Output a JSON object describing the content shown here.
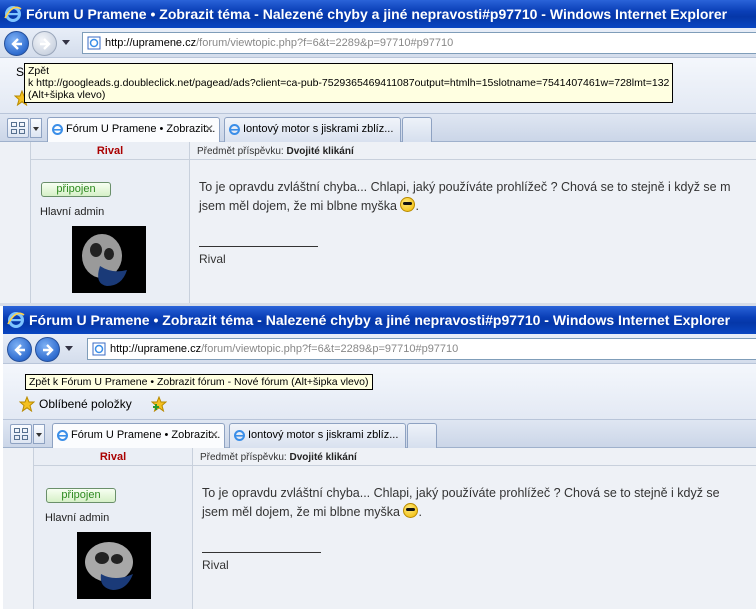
{
  "top": {
    "window_title": "Fórum U Pramene • Zobrazit téma - Nalezené chyby a jiné nepravosti#p97710 - Windows Internet Explorer",
    "url_host": "http://upramene.cz",
    "url_path": "/forum/viewtopic.php?f=6&t=2289&p=97710#p97710",
    "favorites_label": "S",
    "tooltip_lines": [
      "Zpět",
      "k http://googleads.g.doubleclick.net/pagead/ads?client=ca-pub-7529365469411087output=htmlh=15slotname=7541407461w=728lmt=132",
      "(Alt+šipka vlevo)"
    ],
    "tabs": [
      {
        "label": "Fórum U Pramene • Zobrazit...",
        "active": true
      },
      {
        "label": "Iontový motor s jiskrami zblíz...",
        "active": false
      }
    ]
  },
  "bottom": {
    "window_title": "Fórum U Pramene • Zobrazit téma - Nalezené chyby a jiné nepravosti#p97710 - Windows Internet Explorer",
    "url_host": "http://upramene.cz",
    "url_path": "/forum/viewtopic.php?f=6&t=2289&p=97710#p97710",
    "favorites_label": "Oblíbené položky",
    "tooltip": "Zpět k Fórum U Pramene • Zobrazit fórum - Nové fórum (Alt+šipka vlevo)",
    "tabs": [
      {
        "label": "Fórum U Pramene • Zobrazit...",
        "active": true
      },
      {
        "label": "Iontový motor s jiskrami zblíz...",
        "active": false
      }
    ]
  },
  "post": {
    "author": "Rival",
    "subject_label": "Předmět příspěvku:",
    "subject": "Dvojité klikání",
    "status_badge": "připojen",
    "rank": "Hlavní admin",
    "text_line1": "To je opravdu zvláštní chyba... Chlapi, jaký používáte prohlížeč ? Chová se to stejně i když se m",
    "text_line2": "jsem měl dojem, že mi blbne myška",
    "text_line1_bottom": "To je opravdu zvláštní chyba... Chlapi, jaký používáte prohlížeč ? Chová se to stejně i když se",
    "signature": "Rival"
  },
  "colors": {
    "titlebar": "#0a3fb7",
    "author": "#aa0000",
    "online": "#2d8a1f"
  }
}
